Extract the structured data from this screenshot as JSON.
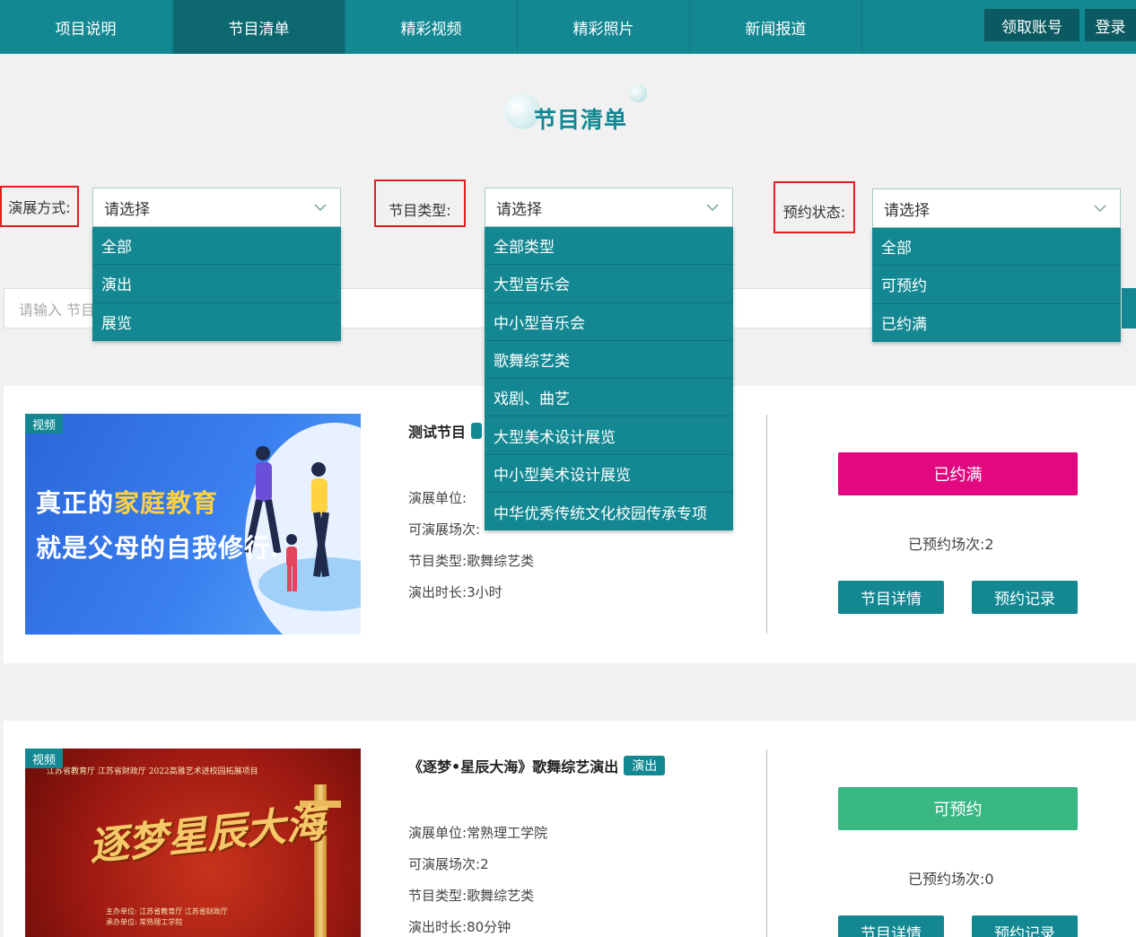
{
  "nav": {
    "tabs": [
      "项目说明",
      "节目清单",
      "精彩视频",
      "精彩照片",
      "新闻报道"
    ],
    "active_index": 1,
    "account_button": "领取账号",
    "login_button": "登录"
  },
  "page_title": "节目清单",
  "filters": {
    "mode": {
      "label": "演展方式:",
      "placeholder": "请选择",
      "options": [
        "全部",
        "演出",
        "展览"
      ]
    },
    "type": {
      "label": "节目类型:",
      "placeholder": "请选择",
      "options": [
        "全部类型",
        "大型音乐会",
        "中小型音乐会",
        "歌舞综艺类",
        "戏剧、曲艺",
        "大型美术设计展览",
        "中小型美术设计展览",
        "中华优秀传统文化校园传承专项"
      ]
    },
    "status": {
      "label": "预约状态:",
      "placeholder": "请选择",
      "options": [
        "全部",
        "可预约",
        "已约满"
      ]
    }
  },
  "search": {
    "placeholder": "请输入 节目"
  },
  "colors": {
    "primary": "#138892",
    "full": "#e2087f",
    "available": "#3ab884"
  },
  "programs": [
    {
      "badge": "视频",
      "title": "测试节目",
      "tag": "",
      "unit_label": "演展单位:",
      "unit_value": "",
      "sessions_label": "可演展场次:",
      "sessions_value": "",
      "type_label": "节目类型:",
      "type_value": "歌舞综艺类",
      "duration_label": "演出时长:",
      "duration_value": "3小时",
      "status": "已约满",
      "booked_label": "已预约场次:",
      "booked_value": "2",
      "detail_button": "节目详情",
      "record_button": "预约记录",
      "image_text": {
        "line1a": "真正的",
        "line1b": "家庭教育",
        "line2": "就是父母的自我修行."
      }
    },
    {
      "badge": "视频",
      "title": "《逐梦•星辰大海》歌舞综艺演出",
      "tag": "演出",
      "unit_label": "演展单位:",
      "unit_value": "常熟理工学院",
      "sessions_label": "可演展场次:",
      "sessions_value": "2",
      "type_label": "节目类型:",
      "type_value": "歌舞综艺类",
      "duration_label": "演出时长:",
      "duration_value": "80分钟",
      "status": "可预约",
      "booked_label": "已预约场次:",
      "booked_value": "0",
      "detail_button": "节目详情",
      "record_button": "预约记录",
      "image_text": {
        "header": "江苏省教育厅  江苏省财政厅  2022高雅艺术进校园拓展项目",
        "big": "逐梦星辰大海",
        "org1": "主办单位: 江苏省教育厅  江苏省财政厅",
        "org2": "承办单位: 常熟理工学院"
      }
    }
  ]
}
